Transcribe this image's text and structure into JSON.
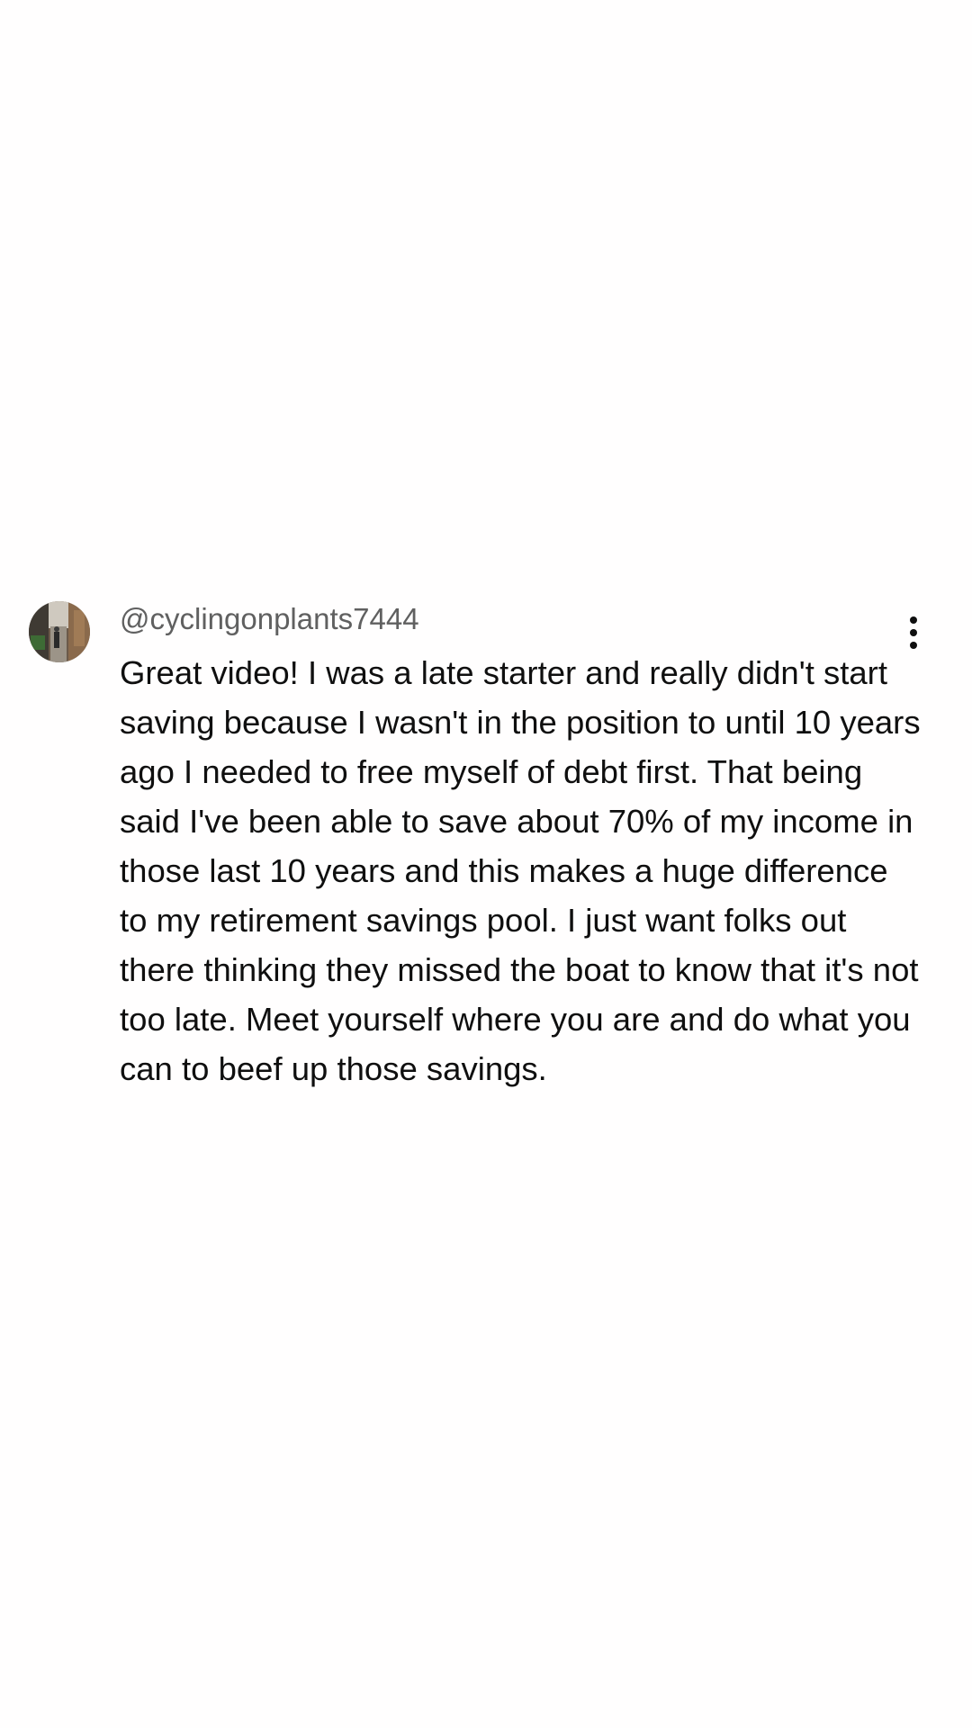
{
  "comment": {
    "author": "@cyclingonplants7444",
    "text": "Great video! I was a late starter and really didn't start saving because I wasn't in the position to until 10 years ago I needed to free myself of debt first. That being said I've been able to save about 70% of my income in those last 10 years and this makes a huge difference to my retirement savings pool. I just want folks out there thinking they missed the boat to know that it's not too late. Meet yourself where you are and do what you can to beef up those savings.",
    "avatar_icon": "avatar-photo",
    "more_icon": "more-vertical-icon"
  },
  "colors": {
    "background": "#fffefe",
    "author_text": "#606060",
    "body_text": "#0f0f0f"
  }
}
